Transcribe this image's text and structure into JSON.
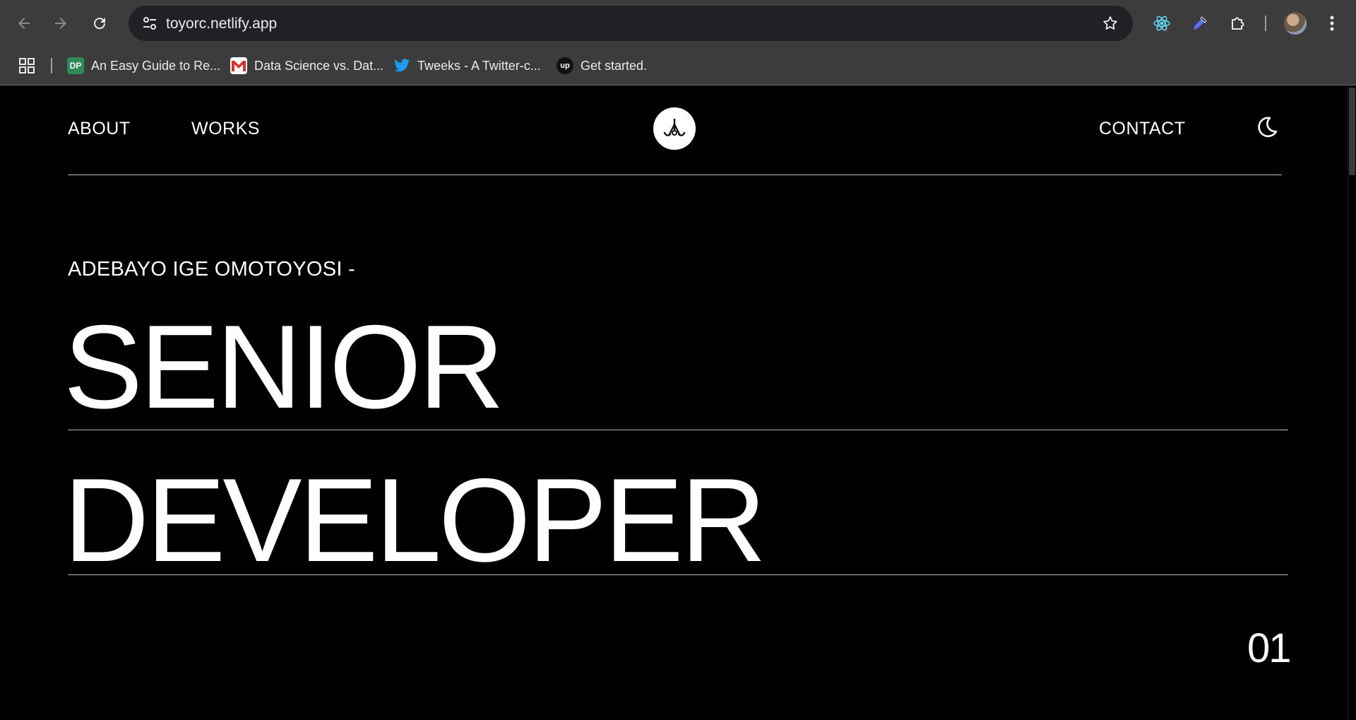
{
  "browser": {
    "url": "toyorc.netlify.app",
    "bookmarks": [
      {
        "label": "An Easy Guide to Re...",
        "icon": "dp-favicon"
      },
      {
        "label": "Data Science vs. Dat...",
        "icon": "gmail-favicon"
      },
      {
        "label": "Tweeks - A Twitter-c...",
        "icon": "twitter-favicon"
      },
      {
        "label": "Get started.",
        "icon": "upwork-favicon"
      }
    ],
    "bookmark_favicon_text": {
      "dp": "DP",
      "upwork": "up"
    }
  },
  "site": {
    "nav": {
      "about": "ABOUT",
      "works": "WORKS",
      "contact": "CONTACT"
    },
    "hero": {
      "subtitle": "ADEBAYO IGE OMOTOYOSI -",
      "line1": "SENIOR",
      "line2": "DEVELOPER",
      "counter": "01"
    }
  },
  "colors": {
    "background": "#000000",
    "text": "#ffffff",
    "chrome": "#3c3c3c"
  }
}
